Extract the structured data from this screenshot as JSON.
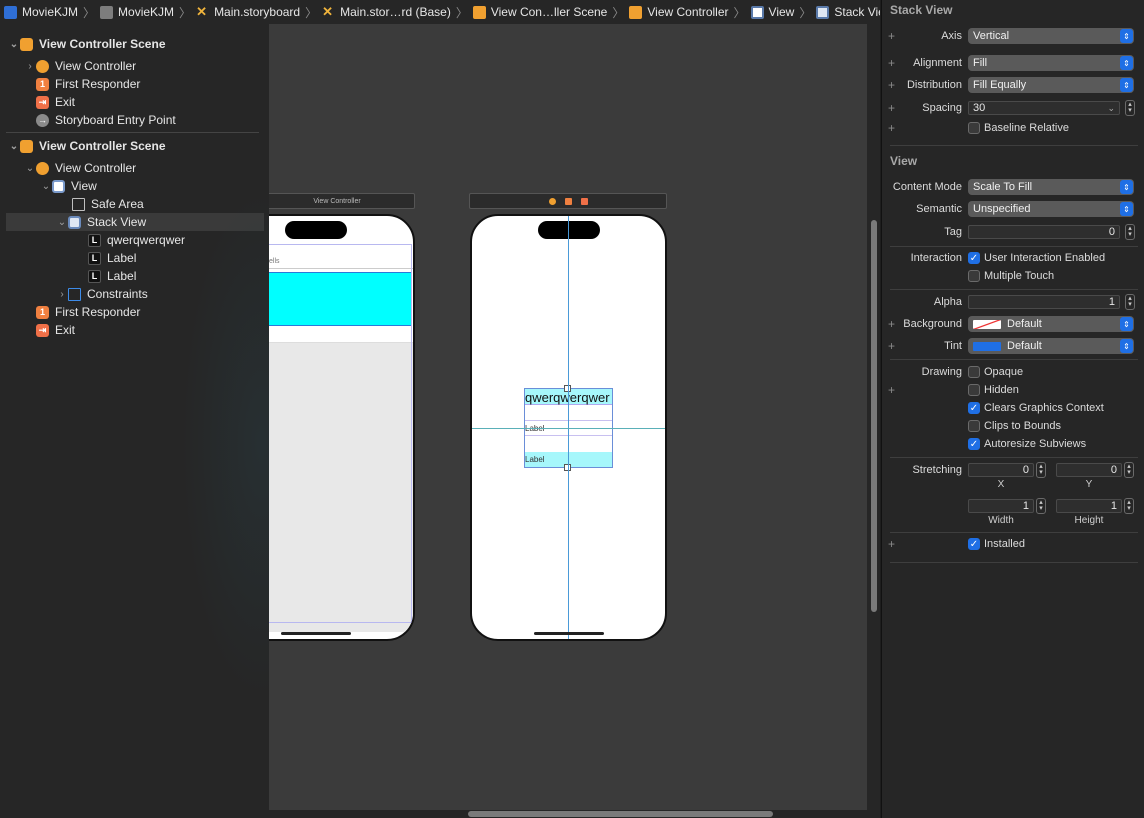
{
  "jumpbar": {
    "crumbs": [
      "MovieKJM",
      "MovieKJM",
      "Main.storyboard",
      "Main.stor…rd (Base)",
      "View Con…ller Scene",
      "View Controller",
      "View",
      "Stack View"
    ]
  },
  "outline": {
    "scene1": {
      "title": "View Controller Scene",
      "items": [
        "View Controller",
        "First Responder",
        "Exit",
        "Storyboard Entry Point"
      ]
    },
    "scene2": {
      "title": "View Controller Scene",
      "vc": "View Controller",
      "view": "View",
      "safe_area": "Safe Area",
      "stack_view": "Stack View",
      "labels": [
        "qwerqwerqwer",
        "Label",
        "Label"
      ],
      "constraints": "Constraints",
      "first_responder": "First Responder",
      "exit": "Exit"
    }
  },
  "canvas": {
    "left_scene_title": "View Controller",
    "left_cell_text": "ells",
    "stack_labels": [
      "qwerqwerqwer",
      "Label",
      "Label"
    ]
  },
  "inspector": {
    "stack_section": "Stack View",
    "axis": {
      "label": "Axis",
      "value": "Vertical"
    },
    "alignment": {
      "label": "Alignment",
      "value": "Fill"
    },
    "distribution": {
      "label": "Distribution",
      "value": "Fill Equally"
    },
    "spacing": {
      "label": "Spacing",
      "value": "30"
    },
    "baseline_relative": "Baseline Relative",
    "view_section": "View",
    "content_mode": {
      "label": "Content Mode",
      "value": "Scale To Fill"
    },
    "semantic": {
      "label": "Semantic",
      "value": "Unspecified"
    },
    "tag": {
      "label": "Tag",
      "value": "0"
    },
    "interaction": {
      "label": "Interaction",
      "user_interaction": "User Interaction Enabled",
      "multiple_touch": "Multiple Touch"
    },
    "alpha": {
      "label": "Alpha",
      "value": "1"
    },
    "background": {
      "label": "Background",
      "value": "Default"
    },
    "tint": {
      "label": "Tint",
      "value": "Default"
    },
    "drawing": {
      "label": "Drawing",
      "opaque": "Opaque",
      "hidden": "Hidden",
      "clears": "Clears Graphics Context",
      "clips": "Clips to Bounds",
      "autoresize": "Autoresize Subviews"
    },
    "stretching": {
      "label": "Stretching",
      "x": "0",
      "y": "0",
      "width": "1",
      "height": "1",
      "x_label": "X",
      "y_label": "Y",
      "width_label": "Width",
      "height_label": "Height"
    },
    "installed": "Installed"
  },
  "colors": {
    "accent": "#1f6fe5",
    "cyan_fill": "#00ffff",
    "guide": "#4a9ad8"
  }
}
